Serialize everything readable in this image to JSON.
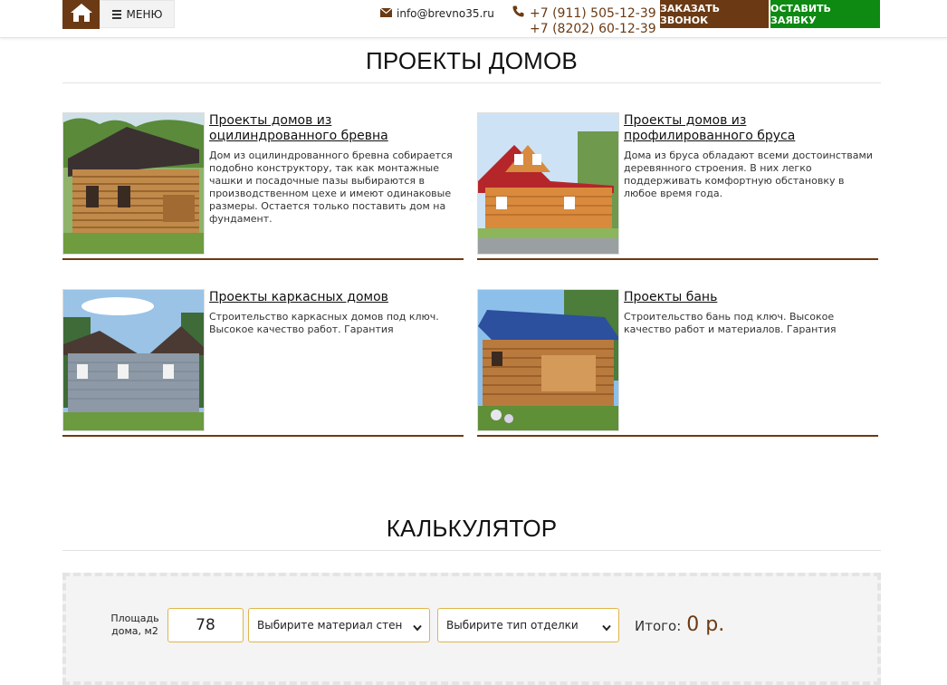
{
  "header": {
    "menu_label": "МЕНЮ",
    "email": "info@brevno35.ru",
    "phone_1": "+7 (911) 505-12-39",
    "phone_2": "+7 (8202) 60-12-39",
    "call_button": "ЗАКАЗАТЬ ЗВОНОК",
    "request_button": "ОСТАВИТЬ ЗАЯВКУ"
  },
  "colors": {
    "brand_brown": "#6b3a14",
    "brand_green": "#0e8a12",
    "input_border": "#e0b54a"
  },
  "icons": [
    "home-icon",
    "menu-bars-icon",
    "envelope-icon",
    "phone-icon",
    "chevron-down-icon"
  ],
  "projects": {
    "title": "ПРОЕКТЫ ДОМОВ",
    "cards": [
      {
        "title": "Проекты домов из оцилиндрованного бревна",
        "description": "Дом из оцилиндрованного бревна собирается подобно конструктору, так как монтажные чашки и посадочные пазы выбираются в производственном цехе и имеют одинаковые размеры. Остается только поставить дом на фундамент."
      },
      {
        "title": "Проекты домов из профилированного бруса",
        "description": "Дома из бруса обладают всеми достоинствами деревянного строения. В них легко поддерживать комфортную обстановку в любое время года."
      },
      {
        "title": "Проекты каркасных домов",
        "description": "Строительство каркасных домов под ключ. Высокое качество работ. Гарантия"
      },
      {
        "title": "Проекты бань",
        "description": "Строительство бань под ключ. Высокое качество работ и материалов. Гарантия"
      }
    ]
  },
  "calculator": {
    "title": "КАЛЬКУЛЯТОР",
    "area_label": "Площадь дома, м2",
    "area_value": "78",
    "wall_material_select": "Выбирите материал стен",
    "finish_type_select": "Выбирите тип отделки",
    "total_label": "Итого:",
    "total_value": "0 р."
  }
}
